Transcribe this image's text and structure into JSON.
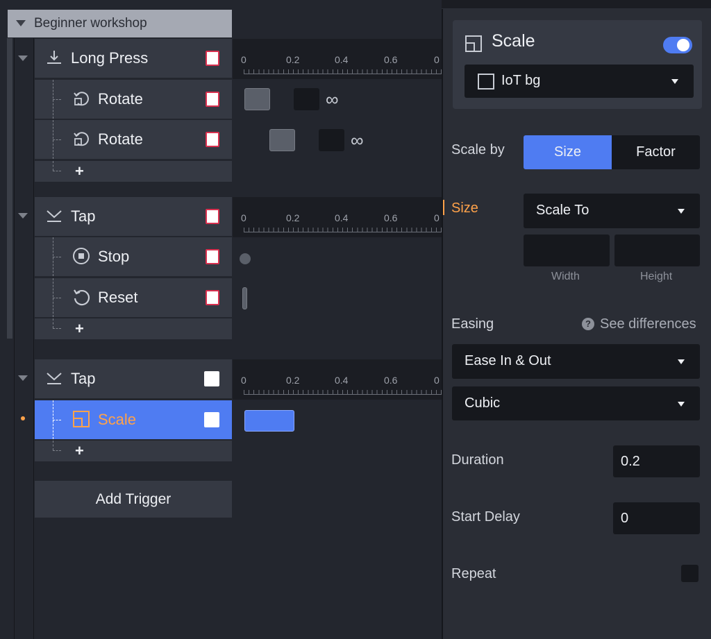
{
  "folder": {
    "title": "Beginner workshop"
  },
  "ruler_labels": [
    "0",
    "0.2",
    "0.4",
    "0.6",
    "0"
  ],
  "triggers": [
    {
      "label": "Long Press",
      "icon": "long-press-icon",
      "actions": [
        {
          "label": "Rotate",
          "icon": "rotate-icon"
        },
        {
          "label": "Rotate",
          "icon": "rotate-icon"
        }
      ]
    },
    {
      "label": "Tap",
      "icon": "tap-icon",
      "actions": [
        {
          "label": "Stop",
          "icon": "stop-icon"
        },
        {
          "label": "Reset",
          "icon": "reset-icon"
        }
      ]
    },
    {
      "label": "Tap",
      "icon": "tap-icon",
      "actions": [
        {
          "label": "Scale",
          "icon": "scale-icon",
          "selected": true
        }
      ]
    }
  ],
  "add_action_label": "+",
  "infinity": "∞",
  "add_trigger_label": "Add Trigger",
  "panel": {
    "title": "Scale",
    "enabled": true,
    "target": "IoT bg",
    "scale_by_label": "Scale by",
    "scale_by_options": [
      "Size",
      "Factor"
    ],
    "scale_by_selected": "Size",
    "size_label": "Size",
    "size_mode": "Scale To",
    "width_label": "Width",
    "height_label": "Height",
    "width_value": "",
    "height_value": "",
    "easing_label": "Easing",
    "see_differences": "See differences",
    "help_glyph": "?",
    "easing_type": "Ease In & Out",
    "easing_curve": "Cubic",
    "duration_label": "Duration",
    "duration_value": "0.2",
    "start_delay_label": "Start Delay",
    "start_delay_value": "0",
    "repeat_label": "Repeat",
    "repeat_checked": false
  },
  "colors": {
    "accent": "#4f7cf2",
    "highlight": "#ffa24a",
    "alert_border": "#d9304f"
  }
}
